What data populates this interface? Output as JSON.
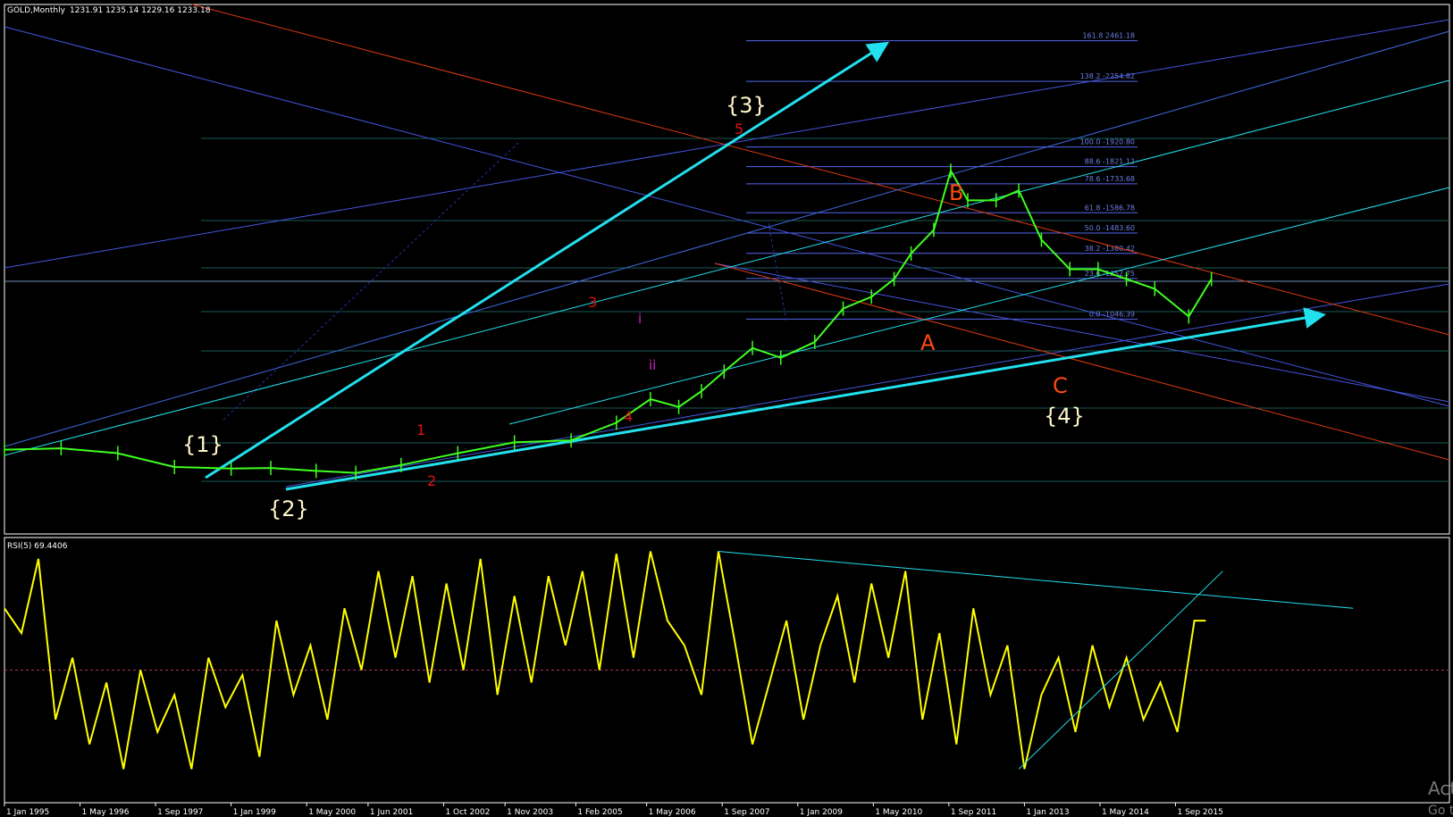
{
  "header": {
    "symbol": "GOLD,Monthly",
    "ohlc": "1231.91 1235.14 1229.16 1233.18"
  },
  "rsi_header": "RSI(5) 69.4406",
  "wave_labels": {
    "w1": "{1}",
    "w2": "{2}",
    "w3": "{3}",
    "w4": "{4}",
    "a": "A",
    "b": "B",
    "c": "C",
    "s1": "1",
    "s2": "2",
    "s3": "3",
    "s4": "4",
    "s5": "5",
    "mi": "i",
    "mii": "ii"
  },
  "watermark": {
    "line1": "Act",
    "line2": "Go t"
  },
  "colors": {
    "background": "#000000",
    "candle": "#3fff1f",
    "rsi": "#ffff00",
    "trend_cyan": "#22e0ee",
    "channel_blue": "#4455dd",
    "channel_red": "#dd3a10",
    "grid_teal": "#1a5a5a",
    "fib": "#5566ee"
  },
  "chart_data": [
    {
      "type": "line",
      "title": "GOLD,Monthly",
      "ylabel": "",
      "xlabel": "",
      "x_ticks": [
        "1 Jan 1995",
        "1 May 1996",
        "1 Sep 1997",
        "1 Jan 1999",
        "1 May 2000",
        "1 Jun 2001",
        "1 Oct 2002",
        "1 Nov 2003",
        "1 Feb 2005",
        "1 May 2006",
        "1 Sep 2007",
        "1 Jan 2009",
        "1 May 2010",
        "1 Sep 2011",
        "1 Jan 2013",
        "1 May 2014",
        "1 Sep 2015"
      ],
      "x": [
        1995.0,
        1996.0,
        1997.0,
        1998.0,
        1999.0,
        1999.7,
        2000.5,
        2001.2,
        2002.0,
        2003.0,
        2004.0,
        2005.0,
        2005.8,
        2006.4,
        2006.9,
        2007.3,
        2007.7,
        2008.2,
        2008.7,
        2009.3,
        2009.8,
        2010.3,
        2010.7,
        2011.0,
        2011.4,
        2011.7,
        2012.0,
        2012.5,
        2012.9,
        2013.3,
        2013.8,
        2014.3,
        2014.8,
        2015.3,
        2015.9,
        2016.3
      ],
      "series": [
        {
          "values": [
            383,
            390,
            365,
            295,
            287,
            290,
            275,
            265,
            305,
            365,
            420,
            430,
            520,
            640,
            600,
            680,
            780,
            900,
            850,
            930,
            1100,
            1160,
            1250,
            1380,
            1500,
            1800,
            1650,
            1650,
            1700,
            1450,
            1300,
            1300,
            1250,
            1200,
            1060,
            1250
          ]
        }
      ],
      "fibonacci_levels": [
        {
          "label": "161.8 2461.18",
          "value": 2461.18
        },
        {
          "label": "138.2 -2254.82",
          "value": 2254.82
        },
        {
          "label": "100.0 -1920.80",
          "value": 1920.8
        },
        {
          "label": "88.6 -1821.12",
          "value": 1821.12
        },
        {
          "label": "78.6 -1733.68",
          "value": 1733.68
        },
        {
          "label": "61.8 -1586.78",
          "value": 1586.78
        },
        {
          "label": "50.0 -1483.60",
          "value": 1483.6
        },
        {
          "label": "38.2 -1380.42",
          "value": 1380.42
        },
        {
          "label": "23.6 -1252.75",
          "value": 1252.75
        },
        {
          "label": "0.0 -1046.39",
          "value": 1046.39
        }
      ]
    },
    {
      "type": "line",
      "title": "RSI(5) 69.4406",
      "ylim": [
        0,
        100
      ],
      "x": [
        1995.0,
        1995.3,
        1995.6,
        1995.9,
        1996.2,
        1996.5,
        1996.8,
        1997.1,
        1997.4,
        1997.7,
        1998.0,
        1998.3,
        1998.6,
        1998.9,
        1999.2,
        1999.5,
        1999.8,
        2000.1,
        2000.4,
        2000.7,
        2001.0,
        2001.3,
        2001.6,
        2001.9,
        2002.2,
        2002.5,
        2002.8,
        2003.1,
        2003.4,
        2003.7,
        2004.0,
        2004.3,
        2004.6,
        2004.9,
        2005.2,
        2005.5,
        2005.8,
        2006.1,
        2006.4,
        2006.7,
        2007.0,
        2007.3,
        2007.6,
        2007.9,
        2008.2,
        2008.5,
        2008.8,
        2009.1,
        2009.4,
        2009.7,
        2010.0,
        2010.3,
        2010.6,
        2010.9,
        2011.2,
        2011.5,
        2011.8,
        2012.1,
        2012.4,
        2012.7,
        2013.0,
        2013.3,
        2013.6,
        2013.9,
        2014.2,
        2014.5,
        2014.8,
        2015.1,
        2015.4,
        2015.7,
        2016.0,
        2016.2
      ],
      "values": [
        75,
        65,
        95,
        30,
        55,
        20,
        45,
        10,
        50,
        25,
        40,
        10,
        55,
        35,
        48,
        15,
        70,
        40,
        60,
        30,
        75,
        50,
        90,
        55,
        88,
        45,
        85,
        50,
        95,
        40,
        80,
        45,
        88,
        60,
        90,
        50,
        97,
        55,
        98,
        70,
        60,
        40,
        98,
        60,
        20,
        45,
        70,
        30,
        60,
        80,
        45,
        85,
        55,
        90,
        30,
        65,
        20,
        75,
        40,
        60,
        10,
        40,
        55,
        25,
        60,
        35,
        55,
        30,
        45,
        25,
        70,
        70
      ],
      "reference_lines": [
        50
      ]
    }
  ]
}
